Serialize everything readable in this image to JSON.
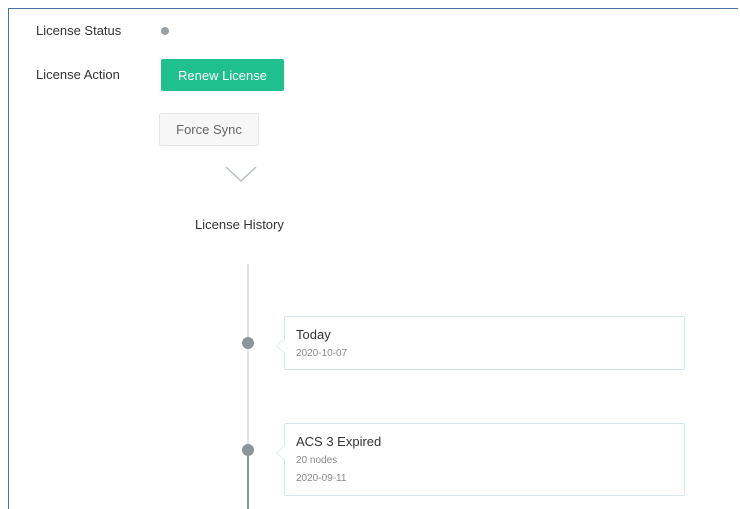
{
  "license": {
    "status_label": "License Status",
    "action_label": "License Action",
    "renew_button": "Renew License",
    "force_sync_button": "Force Sync",
    "history_title": "License History"
  },
  "timeline": [
    {
      "title": "Today",
      "details": [
        "2020-10-07"
      ]
    },
    {
      "title": "ACS 3 Expired",
      "details": [
        "20 nodes",
        "2020-09-11"
      ]
    }
  ],
  "colors": {
    "accent": "#1fc08e",
    "status_dot": "#9aa0a3",
    "timeline_node": "#8c9599",
    "card_border": "#d6e7ec"
  },
  "icons": {
    "expand": "chevron-down-icon",
    "status": "status-dot-icon"
  }
}
